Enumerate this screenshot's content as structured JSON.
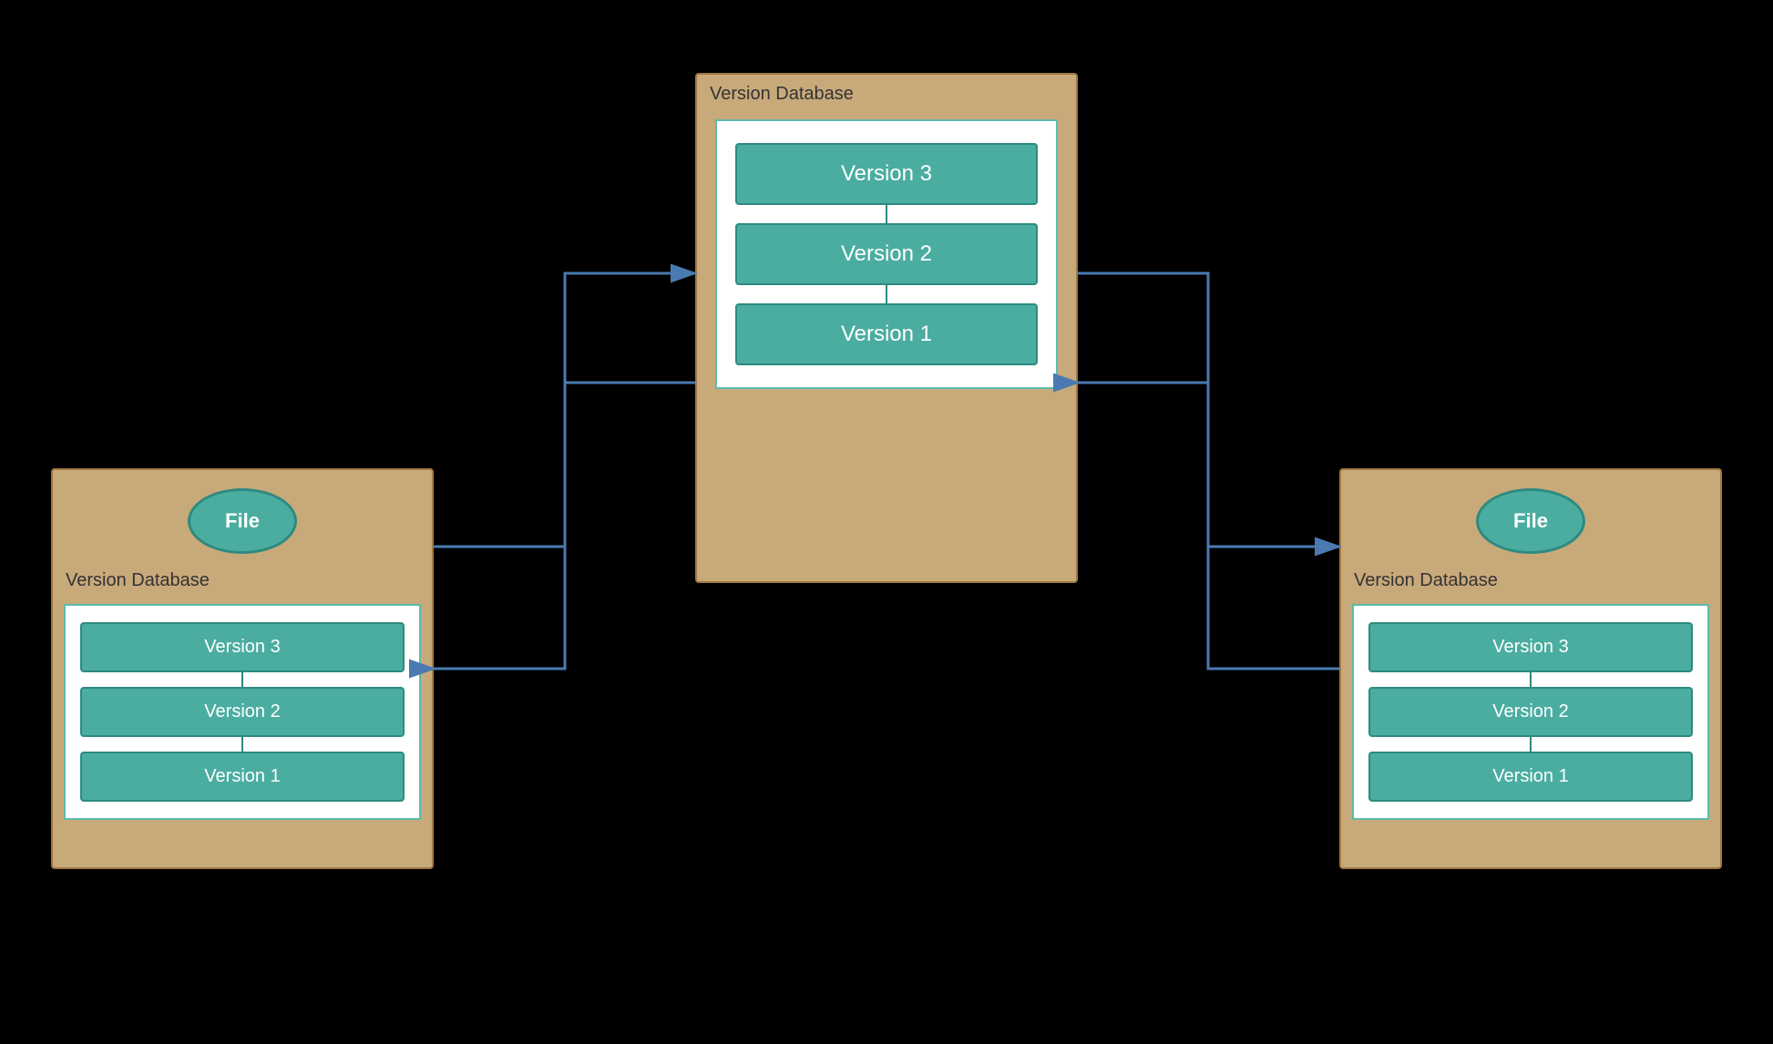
{
  "center": {
    "label": "Version Database",
    "versions": [
      "Version 3",
      "Version 2",
      "Version 1"
    ]
  },
  "left": {
    "label": "Version Database",
    "file_label": "File",
    "versions": [
      "Version 3",
      "Version 2",
      "Version 1"
    ]
  },
  "right": {
    "label": "Version Database",
    "file_label": "File",
    "versions": [
      "Version 3",
      "Version 2",
      "Version 1"
    ]
  },
  "arrows": {
    "color": "#4a7ab0"
  }
}
